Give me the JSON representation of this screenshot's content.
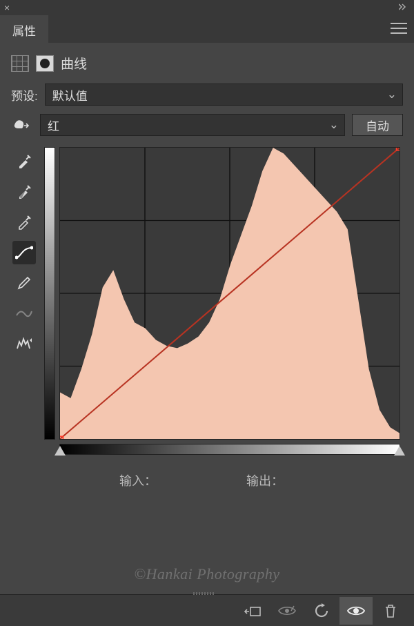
{
  "panel": {
    "tab": "属性",
    "title": "曲线"
  },
  "preset": {
    "label": "预设:",
    "value": "默认值"
  },
  "channel": {
    "value": "红",
    "auto": "自动"
  },
  "io": {
    "input_label": "输入：",
    "input_value": "",
    "output_label": "输出：",
    "output_value": ""
  },
  "watermark": "©Hankai Photography",
  "icons": {
    "close": "close-icon",
    "collapse": "collapse-chevrons-icon",
    "menu": "panel-menu-icon",
    "curves": "curves-grid-icon",
    "mask": "layer-mask-icon",
    "finger": "targeted-adjust-icon",
    "eyedrop_black": "eyedropper-black-icon",
    "eyedrop_gray": "eyedropper-gray-icon",
    "eyedrop_white": "eyedropper-white-icon",
    "curve_edit": "curve-edit-icon",
    "pencil": "pencil-icon",
    "smooth": "smooth-curve-icon",
    "baseline": "histogram-baseline-icon",
    "clip": "clip-to-layer-icon",
    "preview": "preview-toggle-icon",
    "reset": "reset-icon",
    "visible": "visibility-icon",
    "trash": "trash-icon"
  },
  "colors": {
    "histogram_fill": "#f4c6b0",
    "curve": "#b83322",
    "accent_handle": "#ff3a2a"
  },
  "chart_data": {
    "type": "area",
    "title": "",
    "xlabel": "输入",
    "ylabel": "输出",
    "x_range": [
      0,
      255
    ],
    "y_range": [
      0,
      255
    ],
    "grid": true,
    "series": [
      {
        "name": "histogram-red",
        "x": [
          0,
          8,
          16,
          24,
          32,
          40,
          48,
          56,
          64,
          72,
          80,
          88,
          96,
          104,
          112,
          120,
          128,
          136,
          144,
          152,
          160,
          168,
          176,
          184,
          192,
          200,
          208,
          216,
          224,
          232,
          240,
          248,
          255
        ],
        "values": [
          40,
          35,
          60,
          90,
          130,
          145,
          120,
          100,
          95,
          85,
          80,
          78,
          82,
          88,
          100,
          120,
          150,
          175,
          200,
          230,
          250,
          245,
          235,
          225,
          215,
          205,
          195,
          180,
          120,
          60,
          25,
          10,
          5
        ]
      },
      {
        "name": "curve",
        "points": [
          [
            0,
            0
          ],
          [
            255,
            255
          ]
        ]
      }
    ],
    "sliders": {
      "black": 0,
      "white": 255
    }
  }
}
